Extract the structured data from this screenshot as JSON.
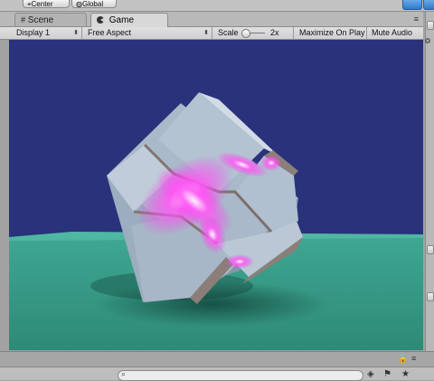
{
  "top": {
    "center_label": "Center",
    "global_label": "Global"
  },
  "tabs": [
    {
      "label": "Scene",
      "icon": "grid-icon",
      "active": false
    },
    {
      "label": "Game",
      "icon": "pacman-icon",
      "active": true
    }
  ],
  "tab_menu_icon": "menu-icon",
  "toolbar": {
    "display": "Display 1",
    "aspect": "Free Aspect",
    "scale_label": "Scale",
    "scale_value": "2x",
    "maximize": "Maximize On Play",
    "mute": "Mute Audio"
  },
  "colors": {
    "sky": "#29327a",
    "ground": "#3aa08a",
    "cube": "#b3c2d3",
    "glow": "#ff4cf5"
  },
  "bottom": {
    "search_placeholder": "",
    "icons": [
      "search-icon",
      "layers-icon",
      "tag-icon",
      "star-icon"
    ]
  }
}
